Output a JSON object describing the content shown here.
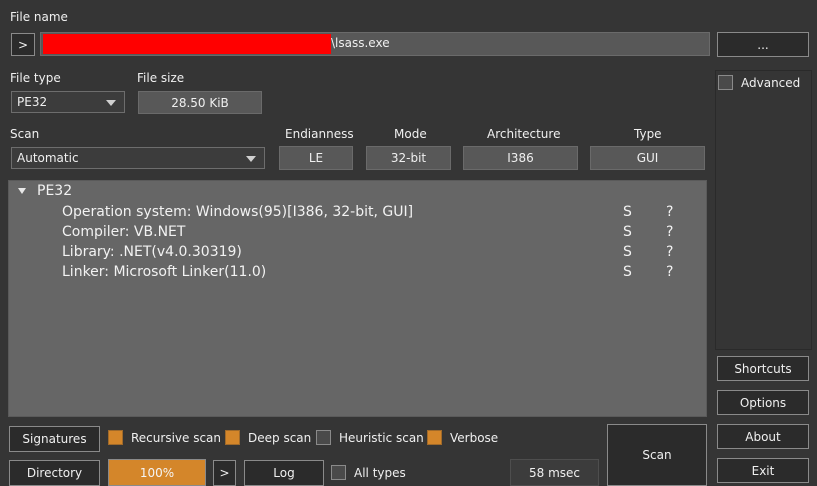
{
  "file": {
    "label": "File name",
    "nav_button": ">",
    "path_visible": "\\lsass.exe",
    "browse_button": "..."
  },
  "file_type": {
    "label": "File type",
    "value": "PE32"
  },
  "file_size": {
    "label": "File size",
    "value": "28.50 KiB"
  },
  "scan": {
    "label": "Scan",
    "value": "Automatic"
  },
  "endianness": {
    "label": "Endianness",
    "value": "LE"
  },
  "mode": {
    "label": "Mode",
    "value": "32-bit"
  },
  "architecture": {
    "label": "Architecture",
    "value": "I386"
  },
  "type": {
    "label": "Type",
    "value": "GUI"
  },
  "advanced": {
    "label": "Advanced",
    "checked": false
  },
  "results": {
    "root": "PE32",
    "items": [
      {
        "text": "Operation system: Windows(95)[I386, 32-bit, GUI]",
        "s": "S",
        "q": "?"
      },
      {
        "text": "Compiler: VB.NET",
        "s": "S",
        "q": "?"
      },
      {
        "text": "Library: .NET(v4.0.30319)",
        "s": "S",
        "q": "?"
      },
      {
        "text": "Linker: Microsoft Linker(11.0)",
        "s": "S",
        "q": "?"
      }
    ]
  },
  "options": {
    "signatures": "Signatures",
    "recursive": {
      "label": "Recursive scan",
      "checked": true
    },
    "deep": {
      "label": "Deep scan",
      "checked": true
    },
    "heuristic": {
      "label": "Heuristic scan",
      "checked": false
    },
    "verbose": {
      "label": "Verbose",
      "checked": true
    }
  },
  "bottom": {
    "directory": "Directory",
    "progress": "100%",
    "progress_fraction": 1.0,
    "expand": ">",
    "log": "Log",
    "all_types": {
      "label": "All types",
      "checked": false
    },
    "time": "58 msec",
    "scan_button": "Scan"
  },
  "side": {
    "shortcuts": "Shortcuts",
    "options": "Options",
    "about": "About",
    "exit": "Exit"
  },
  "colors": {
    "accent": "#d4862a",
    "redaction": "#ff0000",
    "background": "#353535",
    "panel": "#666666"
  }
}
